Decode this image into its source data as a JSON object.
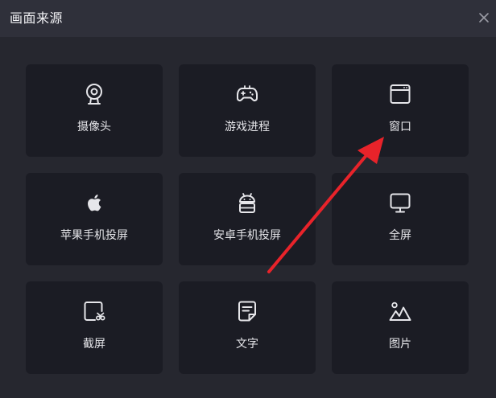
{
  "dialog": {
    "title": "画面来源",
    "close_icon": "close-icon"
  },
  "sources": [
    {
      "id": "camera",
      "label": "摄像头",
      "icon": "webcam-icon"
    },
    {
      "id": "game-process",
      "label": "游戏进程",
      "icon": "gamepad-icon"
    },
    {
      "id": "window",
      "label": "窗口",
      "icon": "window-icon"
    },
    {
      "id": "apple-mirror",
      "label": "苹果手机投屏",
      "icon": "apple-icon"
    },
    {
      "id": "android-mirror",
      "label": "安卓手机投屏",
      "icon": "android-icon"
    },
    {
      "id": "fullscreen",
      "label": "全屏",
      "icon": "monitor-icon"
    },
    {
      "id": "screenshot",
      "label": "截屏",
      "icon": "screenshot-crop-icon"
    },
    {
      "id": "text",
      "label": "文字",
      "icon": "document-text-icon"
    },
    {
      "id": "image",
      "label": "图片",
      "icon": "image-icon"
    }
  ],
  "colors": {
    "background": "#26272f",
    "titlebar": "#2f303a",
    "tile": "#1b1c24",
    "text": "#e6e6ea",
    "annotation_arrow": "#e8232a"
  }
}
